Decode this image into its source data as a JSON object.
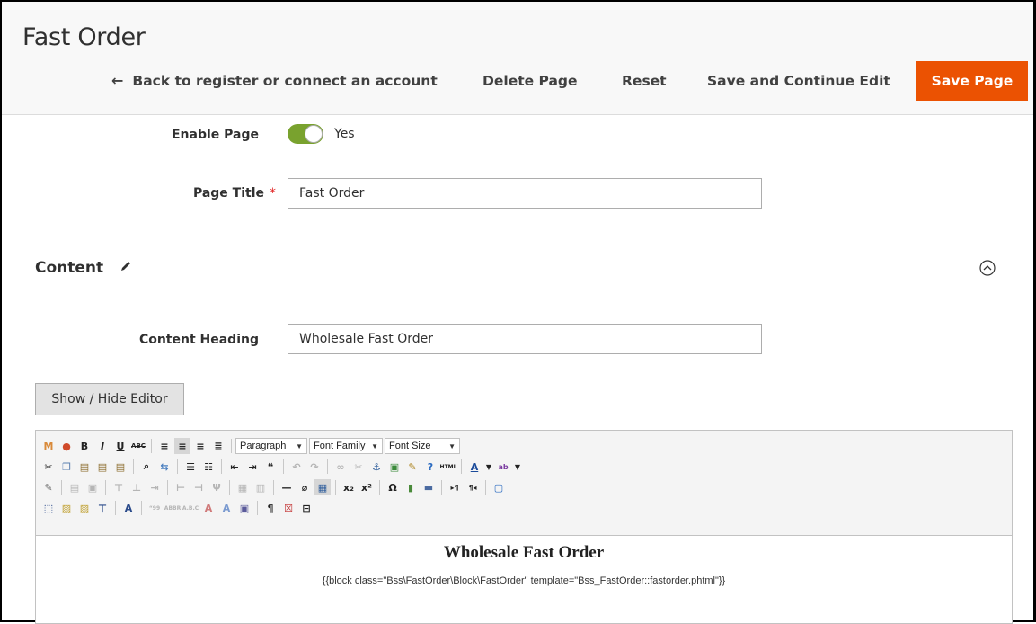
{
  "header": {
    "title": "Fast Order",
    "back_label": "Back to register or connect an account",
    "delete_label": "Delete Page",
    "reset_label": "Reset",
    "save_continue_label": "Save and Continue Edit",
    "save_label": "Save Page",
    "save_color": "#eb5202"
  },
  "form": {
    "enable_page": {
      "label": "Enable Page",
      "value": "Yes",
      "on": true
    },
    "page_title": {
      "label": "Page Title",
      "value": "Fast Order"
    },
    "content_section": {
      "title": "Content"
    },
    "content_heading": {
      "label": "Content Heading",
      "value": "Wholesale Fast Order"
    },
    "show_hide_label": "Show / Hide Editor"
  },
  "editor": {
    "format_select": "Paragraph",
    "font_family_select": "Font Family",
    "font_size_select": "Font Size",
    "content_heading": "Wholesale Fast Order",
    "content_code": "{{block class=\"Bss\\FastOrder\\Block\\FastOrder\" template=\"Bss_FastOrder::fastorder.phtml\"}}"
  }
}
